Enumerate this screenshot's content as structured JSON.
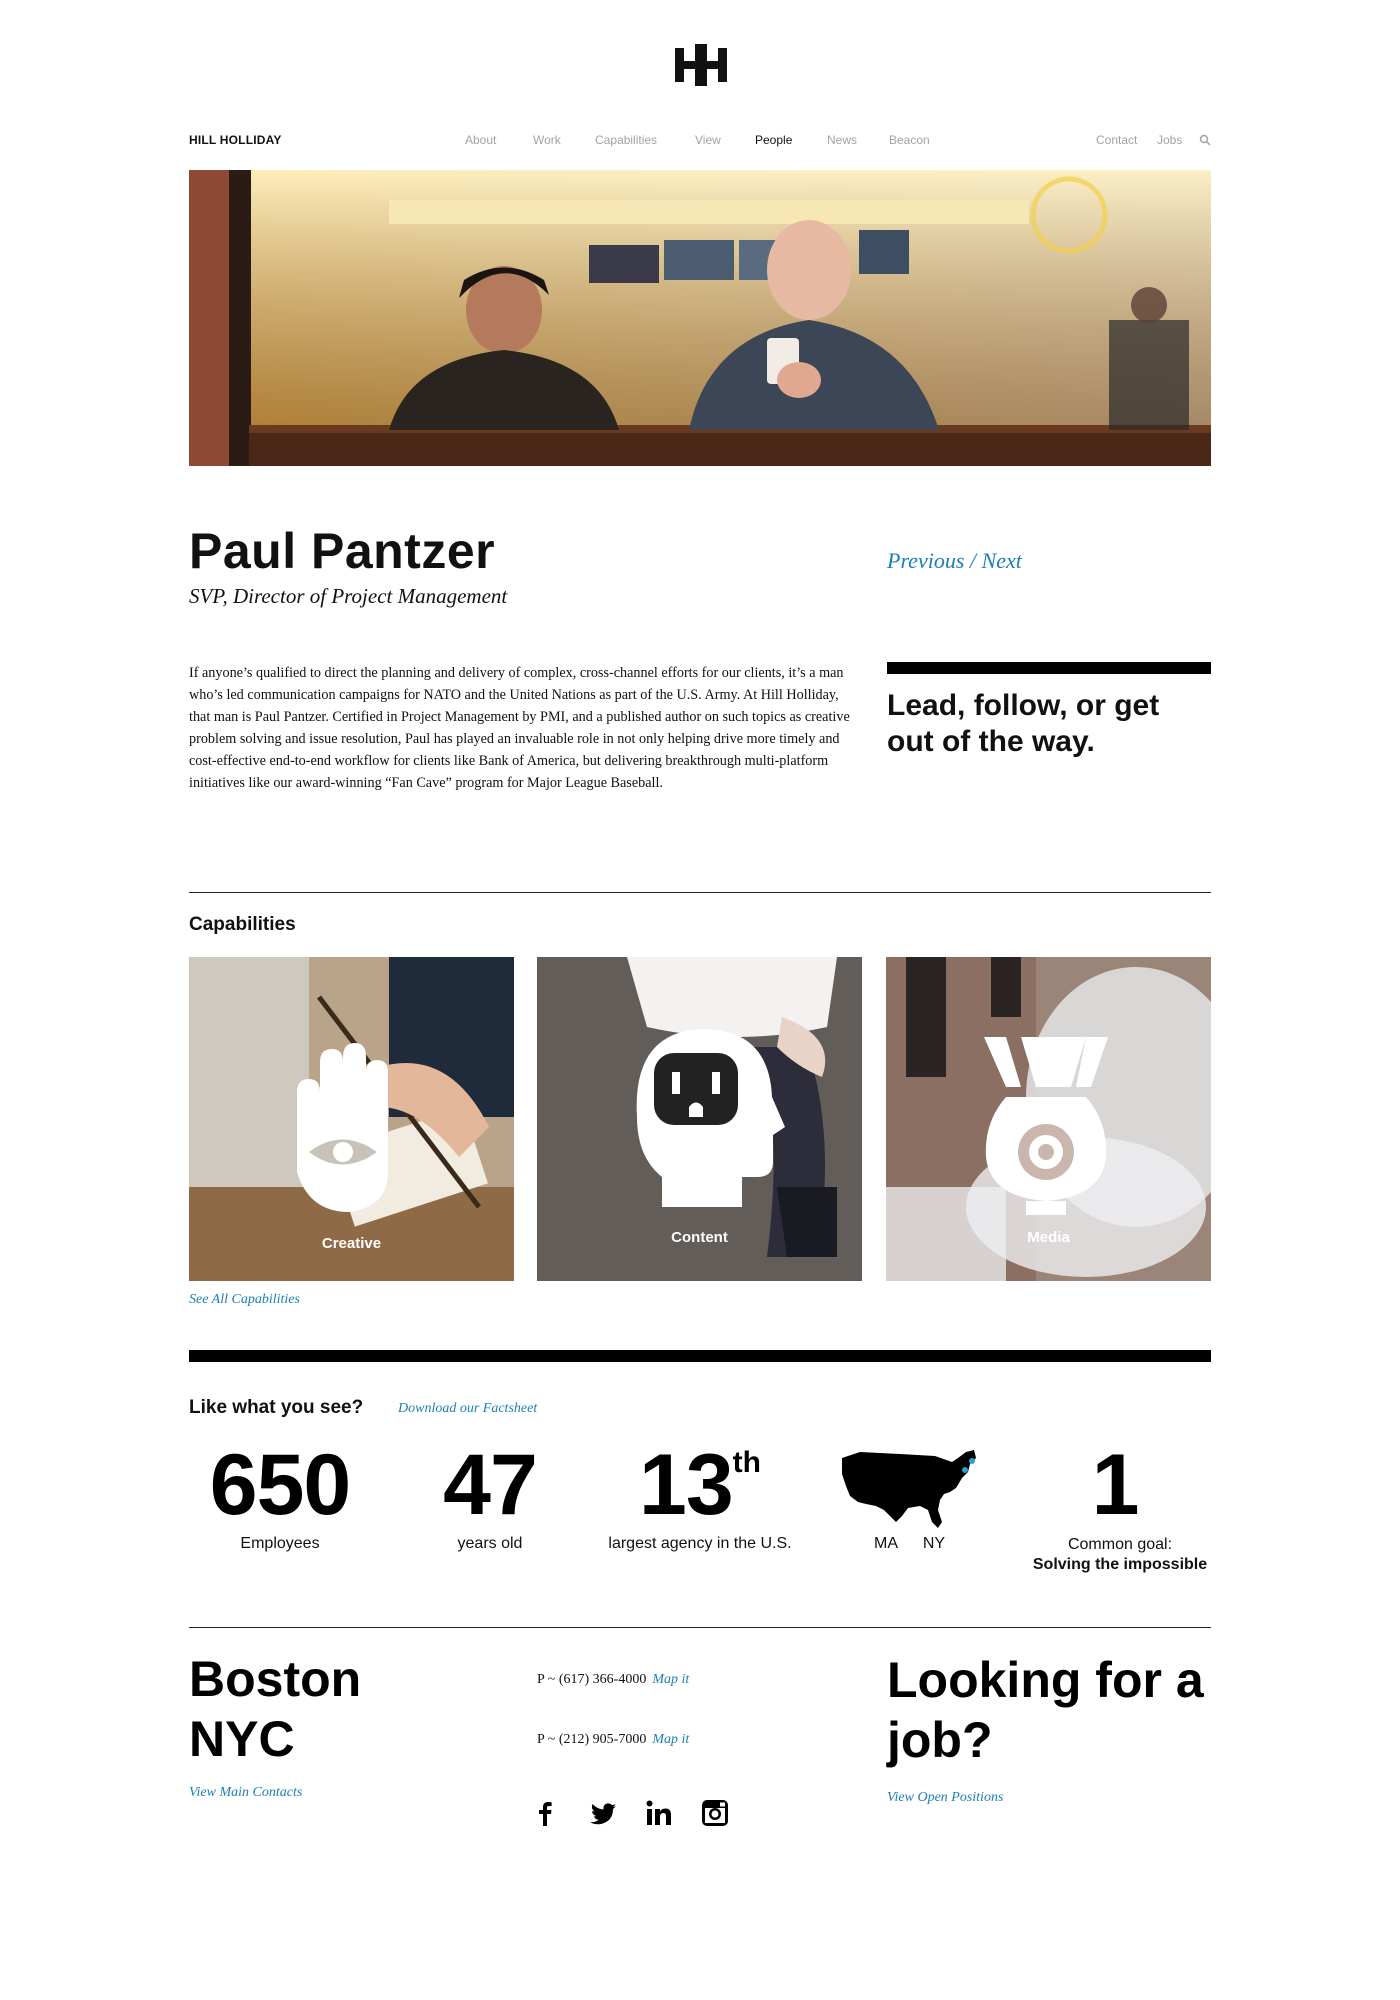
{
  "nav": {
    "brand": "HILL HOLLIDAY",
    "items": [
      "About",
      "Work",
      "Capabilities",
      "View",
      "People",
      "News",
      "Beacon"
    ],
    "active": "People",
    "right_items": [
      "Contact",
      "Jobs"
    ],
    "search_icon": "search-icon"
  },
  "profile": {
    "name": "Paul Pantzer",
    "title": "SVP, Director of Project Management",
    "previous_label": "Previous",
    "separator": " / ",
    "next_label": "Next",
    "bio": "If anyone’s qualified to direct the planning and delivery of complex, cross-channel efforts for our clients, it’s a man who’s led communication campaigns for NATO and the United Nations as part of the U.S. Army. At Hill Holliday, that man is Paul Pantzer. Certified in Project Management by PMI, and a published author on such topics as creative problem solving and issue resolution, Paul has played an invaluable role in not only helping drive more timely and cost-effective end-to-end workflow for clients like Bank of America, but delivering breakthrough multi-platform initiatives like our award-winning “Fan Cave” program for Major League Baseball.",
    "quote": "Lead, follow, or get out of the way."
  },
  "capabilities": {
    "heading": "Capabilities",
    "tiles": [
      {
        "label": "Creative",
        "icon": "hand-eye-icon"
      },
      {
        "label": "Content",
        "icon": "head-outlet-icon"
      },
      {
        "label": "Media",
        "icon": "megaphone-target-icon"
      }
    ],
    "see_all": "See All Capabilities"
  },
  "stats": {
    "heading": "Like what you see?",
    "factsheet": "Download our Factsheet",
    "items": [
      {
        "number": "650",
        "label": "Employees"
      },
      {
        "number": "47",
        "label": "years old"
      },
      {
        "number": "13",
        "suffix": "th",
        "label": "largest agency in the U.S."
      },
      {
        "map_icon": "us-map-icon",
        "labels": [
          "MA",
          "NY"
        ]
      },
      {
        "number": "1",
        "label": "Common goal:",
        "label_bold": "Solving the impossible"
      }
    ]
  },
  "footer": {
    "locations": [
      "Boston",
      "NYC"
    ],
    "view_contacts": "View Main Contacts",
    "phones": [
      {
        "number": "P ~ (617) 366-4000",
        "map": "Map it"
      },
      {
        "number": "P ~ (212) 905-7000",
        "map": "Map it"
      }
    ],
    "social": [
      "facebook-icon",
      "twitter-icon",
      "linkedin-icon",
      "instagram-icon"
    ],
    "job_heading": "Looking for a job?",
    "view_positions": "View Open Positions"
  },
  "colors": {
    "link": "#1a7fb5",
    "text": "#111111",
    "nav_inactive": "#a3a3a3"
  }
}
